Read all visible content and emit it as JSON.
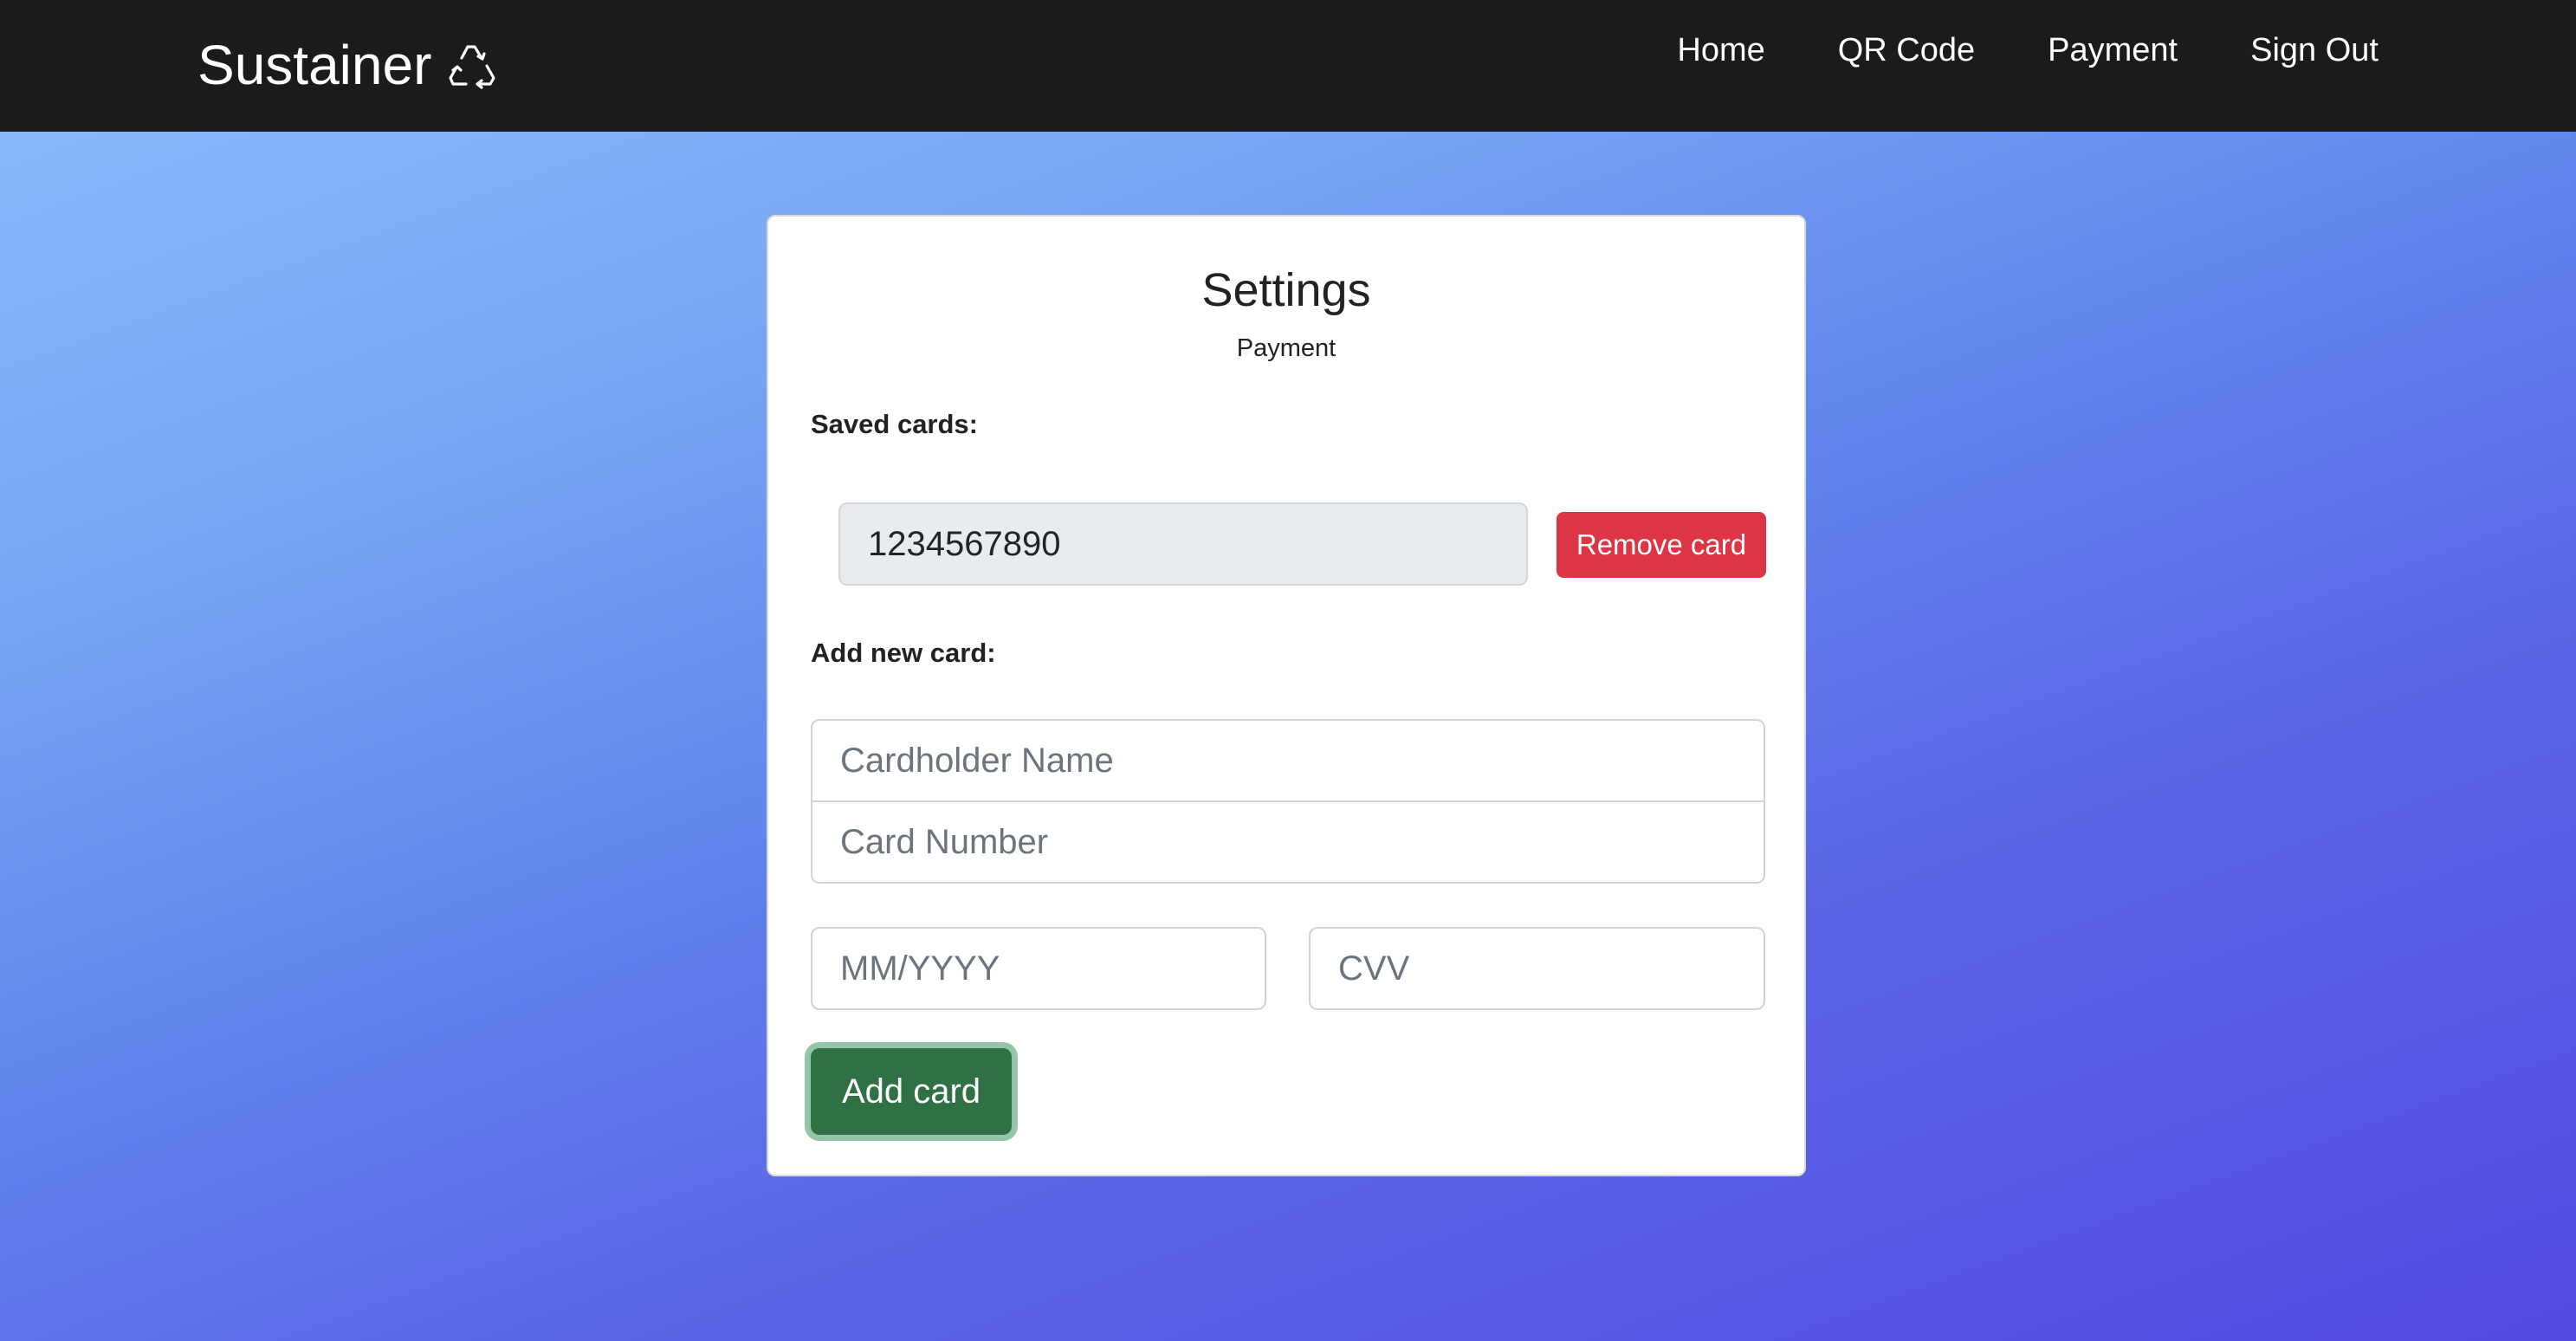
{
  "brand": {
    "name": "Sustainer",
    "icon": "recycle-icon"
  },
  "nav": {
    "items": [
      {
        "label": "Home"
      },
      {
        "label": "QR Code"
      },
      {
        "label": "Payment"
      },
      {
        "label": "Sign Out"
      }
    ]
  },
  "settings": {
    "title": "Settings",
    "subtitle": "Payment",
    "saved_cards_label": "Saved cards:",
    "saved_card_value": "1234567890",
    "remove_card_label": "Remove card",
    "add_new_card_label": "Add new card:",
    "cardholder_placeholder": "Cardholder Name",
    "card_number_placeholder": "Card Number",
    "expiry_placeholder": "MM/YYYY",
    "cvv_placeholder": "CVV",
    "add_card_label": "Add card"
  },
  "colors": {
    "navbar": "#1b1b1c",
    "remove_button": "#dc3545",
    "add_button": "#2f7045",
    "add_button_focus_ring": "#93c5a8",
    "saved_card_bg": "#e9ecef"
  }
}
